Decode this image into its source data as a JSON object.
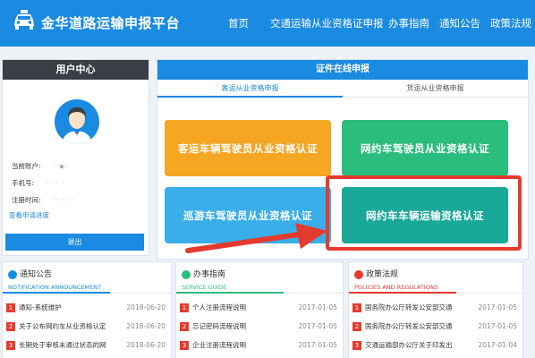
{
  "header": {
    "title": "金华道路运输申报平台",
    "nav": [
      "首页",
      "交通运输从业资格证申报",
      "办事指南",
      "通知公告",
      "政策法规"
    ],
    "logo_icon": "car-icon"
  },
  "user_center": {
    "title": "用户中心",
    "avatar_icon": "user-avatar-icon",
    "fields": [
      {
        "label": "当前账户:",
        "value": "··▪·"
      },
      {
        "label": "手机号:",
        "value": "· ·· ·"
      },
      {
        "label": "注册时间:",
        "value": "··  ·· ·"
      }
    ],
    "progress_link": "查看申请进度",
    "logout_label": "退出"
  },
  "certification": {
    "title": "证件在线申报",
    "tabs": [
      "客运从业资格申报",
      "货运从业资格申报"
    ],
    "active_tab": 0,
    "tiles": [
      {
        "label": "客运车辆驾驶员从业资格认证",
        "color": "#f5a623"
      },
      {
        "label": "网约车驾驶员从业资格认证",
        "color": "#2bbd7e"
      },
      {
        "label": "巡游车驾驶员从业资格认证",
        "color": "#3aaee8"
      },
      {
        "label": "网约车车辆运输资格认证",
        "color": "#1aa898"
      }
    ]
  },
  "panels": [
    {
      "title": "通知公告",
      "subtitle": "NOTIFICATION ANNOUNCEMENT",
      "accent": "#1a8be0",
      "icon": "megaphone-icon",
      "rows": [
        {
          "num": "1",
          "text": "通知-系统维护",
          "date": "2018-06-20"
        },
        {
          "num": "2",
          "text": "关于公布网约车从业资格认定",
          "date": "2018-06-20"
        },
        {
          "num": "3",
          "text": "长期处于审核未通过状态的网",
          "date": "2018-06-20"
        }
      ]
    },
    {
      "title": "办事指南",
      "subtitle": "SERVICE GUIDE",
      "accent": "#2bbd7e",
      "icon": "pencil-icon",
      "rows": [
        {
          "num": "1",
          "text": "个人注册流程说明",
          "date": "2017-01-05"
        },
        {
          "num": "2",
          "text": "忘记密码流程说明",
          "date": "2017-01-05"
        },
        {
          "num": "3",
          "text": "企业注册流程说明",
          "date": "2017-01-05"
        }
      ]
    },
    {
      "title": "政策法规",
      "subtitle": "POLICIES AND REGULATIONS",
      "accent": "#e53b2f",
      "icon": "book-icon",
      "rows": [
        {
          "num": "1",
          "text": "国务院办公厅转发公安部交通",
          "date": "2017-01-05"
        },
        {
          "num": "2",
          "text": "国务院办公厅转发公安部交通",
          "date": "2017-01-05"
        },
        {
          "num": "3",
          "text": "交通运输部办公厅关于印发出",
          "date": "2017-01-04"
        }
      ]
    }
  ]
}
